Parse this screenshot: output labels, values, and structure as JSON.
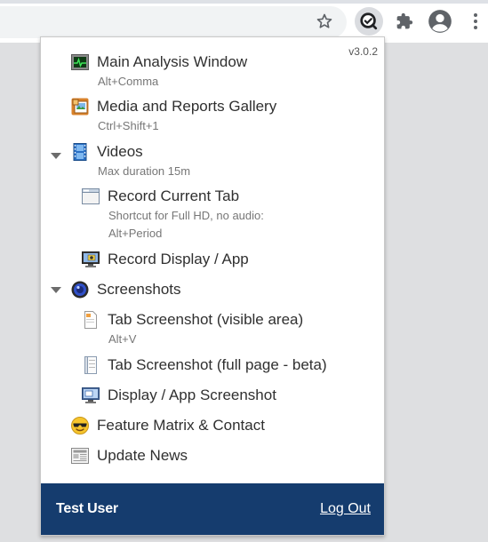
{
  "popup": {
    "version": "v3.0.2",
    "items": [
      {
        "label": "Main Analysis Window",
        "hint": "Alt+Comma",
        "icon": "analysis-window-icon"
      },
      {
        "label": "Media and Reports Gallery",
        "hint": "Ctrl+Shift+1",
        "icon": "gallery-icon"
      },
      {
        "label": "Videos",
        "hint": "Max duration 15m",
        "icon": "film-icon"
      },
      {
        "label": "Record Current Tab",
        "hint": "Shortcut for Full HD, no audio:",
        "hint2": "Alt+Period",
        "icon": "browser-tab-icon"
      },
      {
        "label": "Record Display / App",
        "icon": "monitor-record-icon"
      },
      {
        "label": "Screenshots",
        "icon": "camera-lens-icon"
      },
      {
        "label": "Tab Screenshot (visible area)",
        "hint": "Alt+V",
        "icon": "page-icon"
      },
      {
        "label": "Tab Screenshot (full page - beta)",
        "icon": "full-page-icon"
      },
      {
        "label": "Display / App Screenshot",
        "icon": "monitor-screenshot-icon"
      },
      {
        "label": "Feature Matrix & Contact",
        "icon": "sunglasses-emoji-icon"
      },
      {
        "label": "Update News",
        "icon": "newspaper-icon"
      }
    ]
  },
  "footer": {
    "user": "Test User",
    "logout": "Log Out"
  },
  "colors": {
    "footer_bg": "#153c6e",
    "popup_bg": "#ffffff",
    "page_bg": "#dedfe1"
  }
}
